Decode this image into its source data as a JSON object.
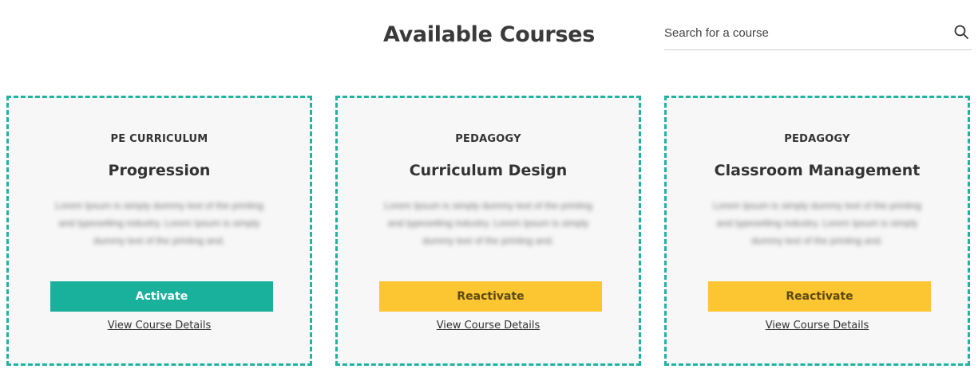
{
  "header": {
    "title": "Available Courses"
  },
  "search": {
    "placeholder": "Search for a course",
    "value": ""
  },
  "courses": [
    {
      "category": "PE CURRICULUM",
      "title": "Progression",
      "description": "Lorem Ipsum is simply dummy text of the printing and typesetting industry. Lorem Ipsum is simply dummy text of the printing and.",
      "button_label": "Activate",
      "details_link": "View Course Details"
    },
    {
      "category": "PEDAGOGY",
      "title": "Curriculum Design",
      "description": "Lorem Ipsum is simply dummy text of the printing and typesetting industry. Lorem Ipsum is simply dummy text of the printing and.",
      "button_label": "Reactivate",
      "details_link": "View Course Details"
    },
    {
      "category": "PEDAGOGY",
      "title": "Classroom Management",
      "description": "Lorem Ipsum is simply dummy text of the printing and typesetting industry. Lorem Ipsum is simply dummy text of the printing and.",
      "button_label": "Reactivate",
      "details_link": "View Course Details"
    }
  ],
  "colors": {
    "accent_teal": "#19b09c",
    "border_teal": "#20b3a0",
    "reactivate_yellow": "#fcc532"
  },
  "icons": {
    "search": "search-icon"
  }
}
